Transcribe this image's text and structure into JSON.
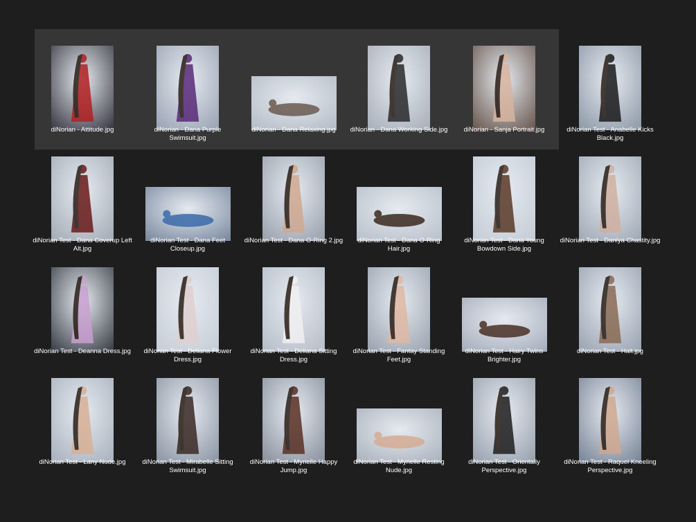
{
  "window": {
    "background": "#1e1e1e",
    "selection_color": "#363636"
  },
  "files": [
    {
      "name": "diNorian - Attitude.jpg",
      "selected": true,
      "orientation": "portrait",
      "icon": "image-thumbnail-icon",
      "bg": "#3a3a44",
      "accent": "#b02020"
    },
    {
      "name": "diNorian - Dana Purple Swimsuit.jpg",
      "selected": true,
      "orientation": "portrait",
      "icon": "image-thumbnail-icon",
      "bg": "#9aa4b4",
      "accent": "#5a2a7a"
    },
    {
      "name": "diNorian - Dana Relaxing.jpg",
      "selected": true,
      "orientation": "landscape",
      "icon": "image-thumbnail-icon",
      "bg": "#b4bcc6",
      "accent": "#6a5a50"
    },
    {
      "name": "diNorian - Dana Working Side.jpg",
      "selected": true,
      "orientation": "portrait",
      "icon": "image-thumbnail-icon",
      "bg": "#a8b0ba",
      "accent": "#2a2a2a"
    },
    {
      "name": "diNorian - Sanja Portrait.jpg",
      "selected": true,
      "orientation": "portrait",
      "icon": "image-thumbnail-icon",
      "bg": "#6a5a52",
      "accent": "#d8b4a0"
    },
    {
      "name": "diNorian Test - Anabelle Kicks Black.jpg",
      "selected": false,
      "orientation": "portrait",
      "icon": "image-thumbnail-icon",
      "bg": "#8e9aa8",
      "accent": "#1a1a1a"
    },
    {
      "name": "diNorian Test - Dana Coverup Left Alt.jpg",
      "selected": false,
      "orientation": "portrait",
      "icon": "image-thumbnail-icon",
      "bg": "#a4acb6",
      "accent": "#6a1a1a"
    },
    {
      "name": "diNorian Test - Dana Feet Closeup.jpg",
      "selected": false,
      "orientation": "landscape",
      "icon": "image-thumbnail-icon",
      "bg": "#7a8aa0",
      "accent": "#3a6aa8"
    },
    {
      "name": "diNorian Test - Dana O-Ring 2.jpg",
      "selected": false,
      "orientation": "portrait",
      "icon": "image-thumbnail-icon",
      "bg": "#9aa2ae",
      "accent": "#d0a890"
    },
    {
      "name": "diNorian Test - Dana O-Ring Hair.jpg",
      "selected": false,
      "orientation": "landscape",
      "icon": "image-thumbnail-icon",
      "bg": "#b8c0ca",
      "accent": "#3a2a20"
    },
    {
      "name": "diNorian Test - Dana Young Bowdown Side.jpg",
      "selected": false,
      "orientation": "portrait",
      "icon": "image-thumbnail-icon",
      "bg": "#c4ccd6",
      "accent": "#5a3a28"
    },
    {
      "name": "diNorian Test - Daniya Chastity.jpg",
      "selected": false,
      "orientation": "portrait",
      "icon": "image-thumbnail-icon",
      "bg": "#a0aab6",
      "accent": "#d0b0a0"
    },
    {
      "name": "diNorian Test - Deanna Dress.jpg",
      "selected": false,
      "orientation": "portrait",
      "icon": "image-thumbnail-icon",
      "bg": "#3c4048",
      "accent": "#c8a0d0"
    },
    {
      "name": "diNorian Test - Deliana Flower Dress.jpg",
      "selected": false,
      "orientation": "portrait",
      "icon": "image-thumbnail-icon",
      "bg": "#c6cdd6",
      "accent": "#e0d0d0"
    },
    {
      "name": "diNorian Test - Deliana Sitting Dress.jpg",
      "selected": false,
      "orientation": "portrait",
      "icon": "image-thumbnail-icon",
      "bg": "#b6bec8",
      "accent": "#f0f0f0"
    },
    {
      "name": "diNorian Test - Fantay Standing Feet.jpg",
      "selected": false,
      "orientation": "portrait",
      "icon": "image-thumbnail-icon",
      "bg": "#9aa4b0",
      "accent": "#e0b8a4"
    },
    {
      "name": "diNorian Test - Hairy Twins Brighter.jpg",
      "selected": false,
      "orientation": "landscape",
      "icon": "image-thumbnail-icon",
      "bg": "#a6aebc",
      "accent": "#4a3026"
    },
    {
      "name": "diNorian Test - Halt.jpg",
      "selected": false,
      "orientation": "portrait",
      "icon": "image-thumbnail-icon",
      "bg": "#9aa4b2",
      "accent": "#8a6a54"
    },
    {
      "name": "diNorian Test - Lany Nude.jpg",
      "selected": false,
      "orientation": "portrait",
      "icon": "image-thumbnail-icon",
      "bg": "#a8b2be",
      "accent": "#d8b096"
    },
    {
      "name": "diNorian Test - Mirabelle Sitting Swimsuit.jpg",
      "selected": false,
      "orientation": "portrait",
      "icon": "image-thumbnail-icon",
      "bg": "#8c96a4",
      "accent": "#3a2a24"
    },
    {
      "name": "diNorian Test - Myrielle Happy Jump.jpg",
      "selected": false,
      "orientation": "portrait",
      "icon": "image-thumbnail-icon",
      "bg": "#8a929e",
      "accent": "#5a3024"
    },
    {
      "name": "diNorian Test - Myrielle Resting Nude.jpg",
      "selected": false,
      "orientation": "landscape",
      "icon": "image-thumbnail-icon",
      "bg": "#aab2bc",
      "accent": "#d4ac94"
    },
    {
      "name": "diNorian Test - Orientally Perspective.jpg",
      "selected": false,
      "orientation": "portrait",
      "icon": "image-thumbnail-icon",
      "bg": "#98a2ae",
      "accent": "#1e1e1e"
    },
    {
      "name": "diNorian Test - Raquel Kneeling Perspective.jpg",
      "selected": false,
      "orientation": "portrait",
      "icon": "image-thumbnail-icon",
      "bg": "#7a8698",
      "accent": "#d0a890"
    }
  ]
}
